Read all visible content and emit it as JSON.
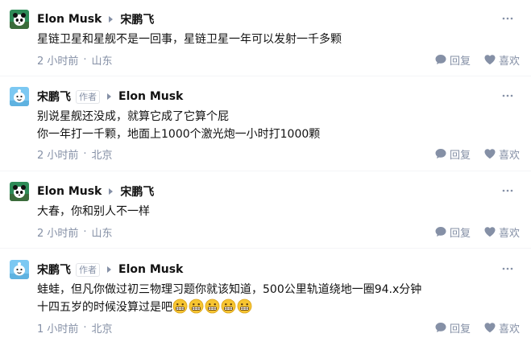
{
  "comments": [
    {
      "author": "Elon Musk",
      "author_tag": "",
      "reply_to": "宋鹏飞",
      "avatar": "panda-avatar",
      "lines": [
        "星链卫星和星舰不是一回事，星链卫星一年可以发射一千多颗"
      ],
      "time": "2 小时前",
      "location": "山东",
      "reply_label": "回复",
      "like_label": "喜欢"
    },
    {
      "author": "宋鹏飞",
      "author_tag": "作者",
      "reply_to": "Elon Musk",
      "avatar": "cartoon-avatar",
      "lines": [
        "别说星舰还没成，就算它成了它算个屁",
        "你一年打一千颗，地面上1000个激光炮一小时打1000颗"
      ],
      "time": "2 小时前",
      "location": "北京",
      "reply_label": "回复",
      "like_label": "喜欢"
    },
    {
      "author": "Elon Musk",
      "author_tag": "",
      "reply_to": "宋鹏飞",
      "avatar": "panda-avatar",
      "lines": [
        "大春，你和别人不一样"
      ],
      "time": "2 小时前",
      "location": "山东",
      "reply_label": "回复",
      "like_label": "喜欢"
    },
    {
      "author": "宋鹏飞",
      "author_tag": "作者",
      "reply_to": "Elon Musk",
      "avatar": "cartoon-avatar",
      "lines": [
        "蛙蛙，但凡你做过初三物理习题你就该知道，500公里轨道绕地一圈94.x分钟",
        "十四五岁的时候没算过是吧"
      ],
      "emoji_count": 5,
      "emoji_name": "grimace-emoji",
      "time": "1 小时前",
      "location": "北京",
      "reply_label": "回复",
      "like_label": "喜欢"
    }
  ],
  "separator": "·",
  "icons": {
    "more": "more-dots-icon",
    "reply": "chat-bubble-icon",
    "like": "heart-icon"
  },
  "colors": {
    "text": "#121212",
    "meta": "#8590a6",
    "icon": "#8590a6"
  }
}
